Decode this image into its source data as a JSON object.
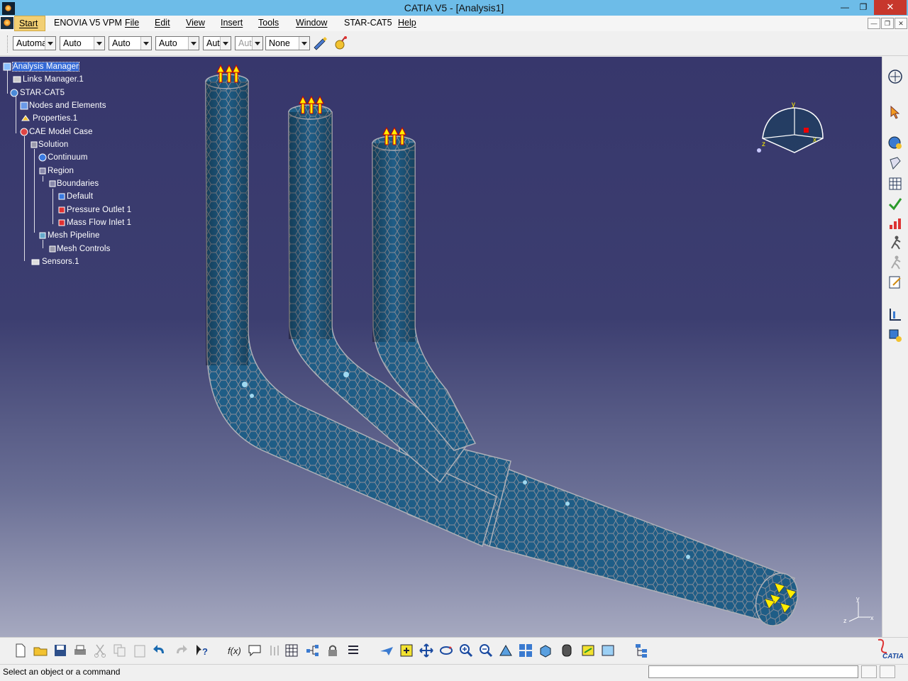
{
  "window": {
    "title": "CATIA V5 - [Analysis1]"
  },
  "menu": {
    "start": "Start",
    "enovia": "ENOVIA V5 VPM",
    "file": "File",
    "edit": "Edit",
    "view": "View",
    "insert": "Insert",
    "tools": "Tools",
    "window": "Window",
    "starcat": "STAR-CAT5",
    "help": "Help"
  },
  "toolbar": {
    "combos": [
      "Automa",
      "Auto",
      "Auto",
      "Auto",
      "Aut",
      "Aut",
      "None"
    ]
  },
  "tree": {
    "root": "Analysis Manager",
    "links": "Links Manager.1",
    "starcat": "STAR-CAT5",
    "nodes": "Nodes and Elements",
    "properties": "Properties.1",
    "cae": "CAE Model Case",
    "solution": "Solution",
    "continuum": "Continuum",
    "region": "Region",
    "boundaries": "Boundaries",
    "default": "Default",
    "outlet": "Pressure Outlet 1",
    "inlet": "Mass Flow Inlet 1",
    "pipeline": "Mesh Pipeline",
    "controls": "Mesh Controls",
    "sensors": "Sensors.1"
  },
  "compass": {
    "x": "x",
    "y": "y",
    "z": "z"
  },
  "axis": {
    "x": "x",
    "y": "y",
    "z": "z"
  },
  "brand": {
    "logo": "CATIA"
  },
  "status": {
    "prompt": "Select an object or a command",
    "input_value": ""
  },
  "colors": {
    "titlebar": "#6dbce8",
    "viewport_top": "#37376c",
    "viewport_bottom": "#a6a9c0",
    "mesh_fill": "#1f5d86",
    "mesh_line": "#8c8f99",
    "load_arrow": "#ffee00"
  }
}
